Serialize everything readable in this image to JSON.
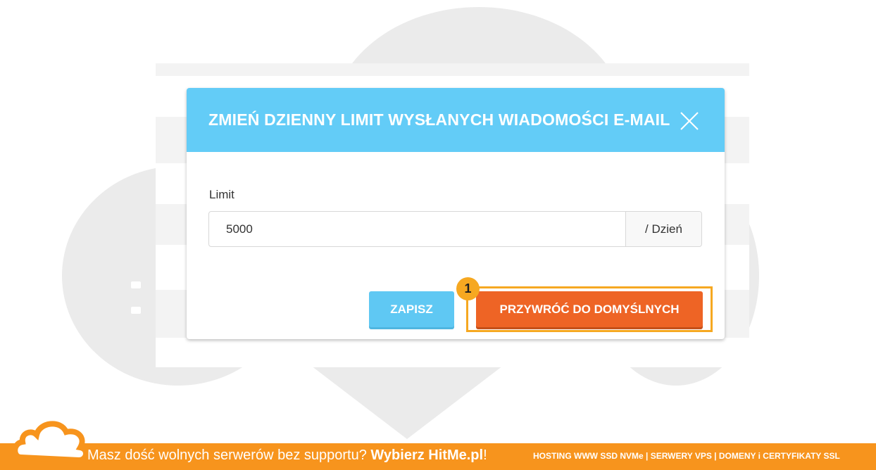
{
  "dialog": {
    "title": "ZMIEŃ DZIENNY LIMIT WYSŁANYCH WIADOMOŚCI E-MAIL",
    "close_icon": "close-icon",
    "field_label": "Limit",
    "limit_value": "5000",
    "unit_addon": "/ Dzień",
    "save_label": "ZAPISZ",
    "restore_label": "PRZYWRÓĆ DO DOMYŚLNYCH"
  },
  "annotation": {
    "step_number": "1",
    "color": "#f6a821"
  },
  "footer": {
    "tagline_prefix": "Masz dość wolnych serwerów bez supportu? ",
    "tagline_brand": "Wybierz HitMe.pl",
    "tagline_suffix": "!",
    "links": "HOSTING WWW SSD NVMe | SERWERY VPS | DOMENY i CERTYFIKATY SSL",
    "logo_icon": "cloud-logo-icon"
  },
  "colors": {
    "header": "#63ccf7",
    "save_button": "#5fc8f3",
    "restore_button": "#ee6425",
    "footer": "#f7941d",
    "background_cloud": "#ebebeb"
  }
}
